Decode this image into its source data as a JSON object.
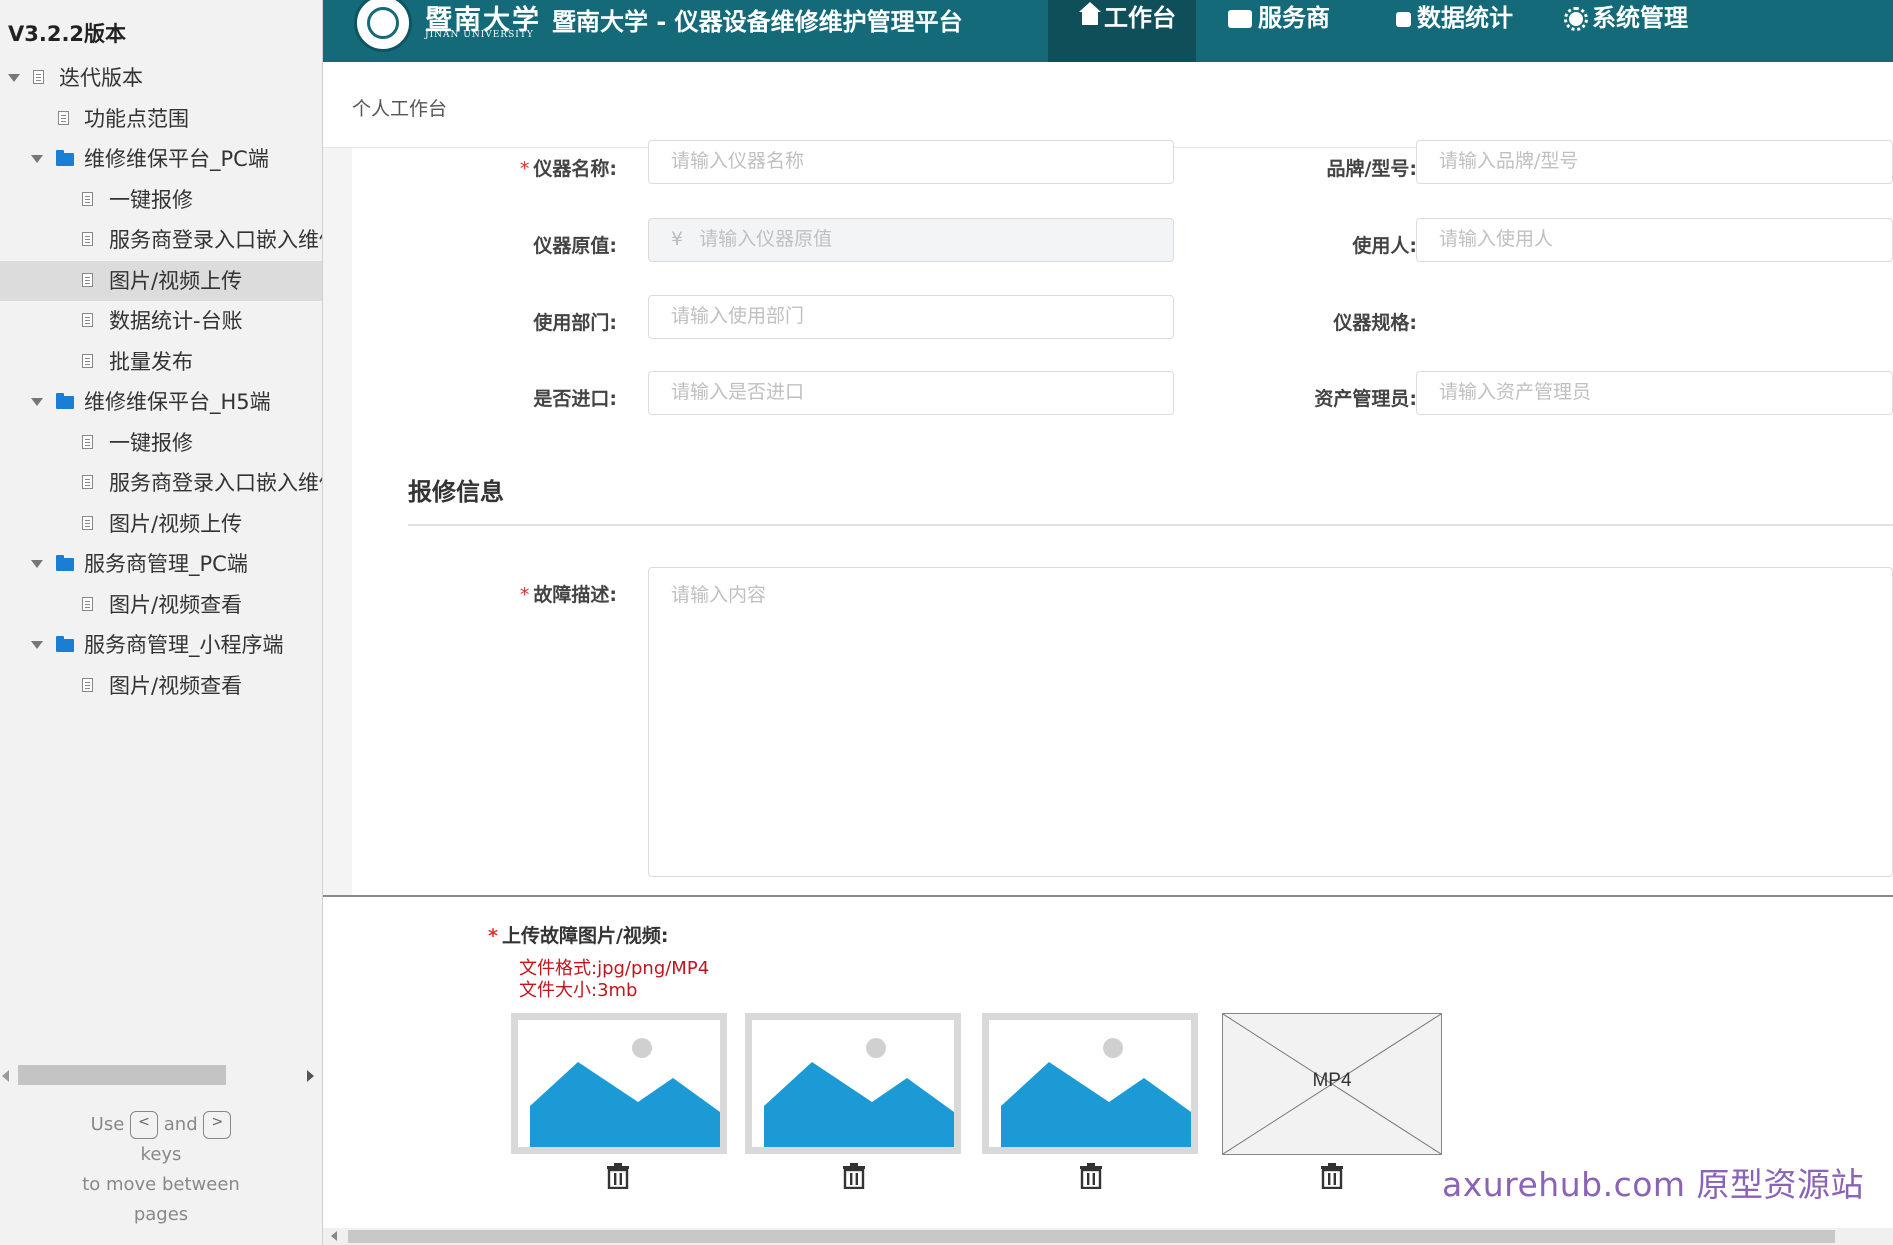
{
  "sidebar": {
    "version": "V3.2.2版本",
    "items": [
      {
        "label": "迭代版本",
        "kind": "page"
      },
      {
        "label": "功能点范围",
        "kind": "page"
      },
      {
        "label": "维修维保平台_PC端",
        "kind": "folder"
      },
      {
        "label": "一键报修",
        "kind": "page"
      },
      {
        "label": "服务商登录入口嵌入维修",
        "kind": "page"
      },
      {
        "label": "图片/视频上传",
        "kind": "page",
        "selected": true
      },
      {
        "label": "数据统计-台账",
        "kind": "page"
      },
      {
        "label": "批量发布",
        "kind": "page"
      },
      {
        "label": "维修维保平台_H5端",
        "kind": "folder"
      },
      {
        "label": "一键报修",
        "kind": "page"
      },
      {
        "label": "服务商登录入口嵌入维修",
        "kind": "page"
      },
      {
        "label": "图片/视频上传",
        "kind": "page"
      },
      {
        "label": "服务商管理_PC端",
        "kind": "folder"
      },
      {
        "label": "图片/视频查看",
        "kind": "page"
      },
      {
        "label": "服务商管理_小程序端",
        "kind": "folder"
      },
      {
        "label": "图片/视频查看",
        "kind": "page"
      }
    ],
    "hint": {
      "use": "Use",
      "key_prev": "<",
      "and": "and",
      "key_next": ">",
      "keys": "keys",
      "line2": "to move between",
      "line3": "pages"
    }
  },
  "header": {
    "logo_cn": "暨南大学",
    "logo_en": "JINAN UNIVERSITY",
    "title": "暨南大学 - 仪器设备维修维护管理平台",
    "nav": [
      {
        "label": "工作台",
        "icon": "home-icon",
        "active": true
      },
      {
        "label": "服务商",
        "icon": "store-icon",
        "active": false
      },
      {
        "label": "数据统计",
        "icon": "chart-icon",
        "active": false
      },
      {
        "label": "系统管理",
        "icon": "gear-icon",
        "active": false
      }
    ],
    "bg_color": "#146a78",
    "active_color": "#0e4f5a"
  },
  "breadcrumb": "个人工作台",
  "form": {
    "instrument_name": {
      "label": "仪器名称:",
      "placeholder": "请输入仪器名称",
      "required": true
    },
    "brand_model": {
      "label": "品牌/型号:",
      "placeholder": "请输入品牌/型号"
    },
    "original_value": {
      "label": "仪器原值:",
      "currency": "¥",
      "placeholder": "请输入仪器原值"
    },
    "user": {
      "label": "使用人:",
      "placeholder": "请输入使用人"
    },
    "department": {
      "label": "使用部门:",
      "placeholder": "请输入使用部门"
    },
    "spec": {
      "label": "仪器规格:",
      "value": ""
    },
    "imported": {
      "label": "是否进口:",
      "placeholder": "请输入是否进口"
    },
    "asset_manager": {
      "label": "资产管理员:",
      "placeholder": "请输入资产管理员"
    },
    "section_title": "报修信息",
    "fault": {
      "label": "故障描述:",
      "placeholder": "请输入内容",
      "required": true
    }
  },
  "upload": {
    "label": "上传故障图片/视频:",
    "format": "文件格式:jpg/png/MP4",
    "size": "文件大小:3mb",
    "items": [
      {
        "type": "image",
        "icon": "image-placeholder-icon"
      },
      {
        "type": "image",
        "icon": "image-placeholder-icon"
      },
      {
        "type": "image",
        "icon": "image-placeholder-icon"
      },
      {
        "type": "video",
        "label": "MP4"
      }
    ]
  },
  "watermark": "axurehub.com 原型资源站",
  "colors": {
    "accent_blue": "#1b9ad6",
    "required_red": "#e0302b",
    "hint_red": "#c0161d",
    "watermark": "#8a63b8"
  }
}
